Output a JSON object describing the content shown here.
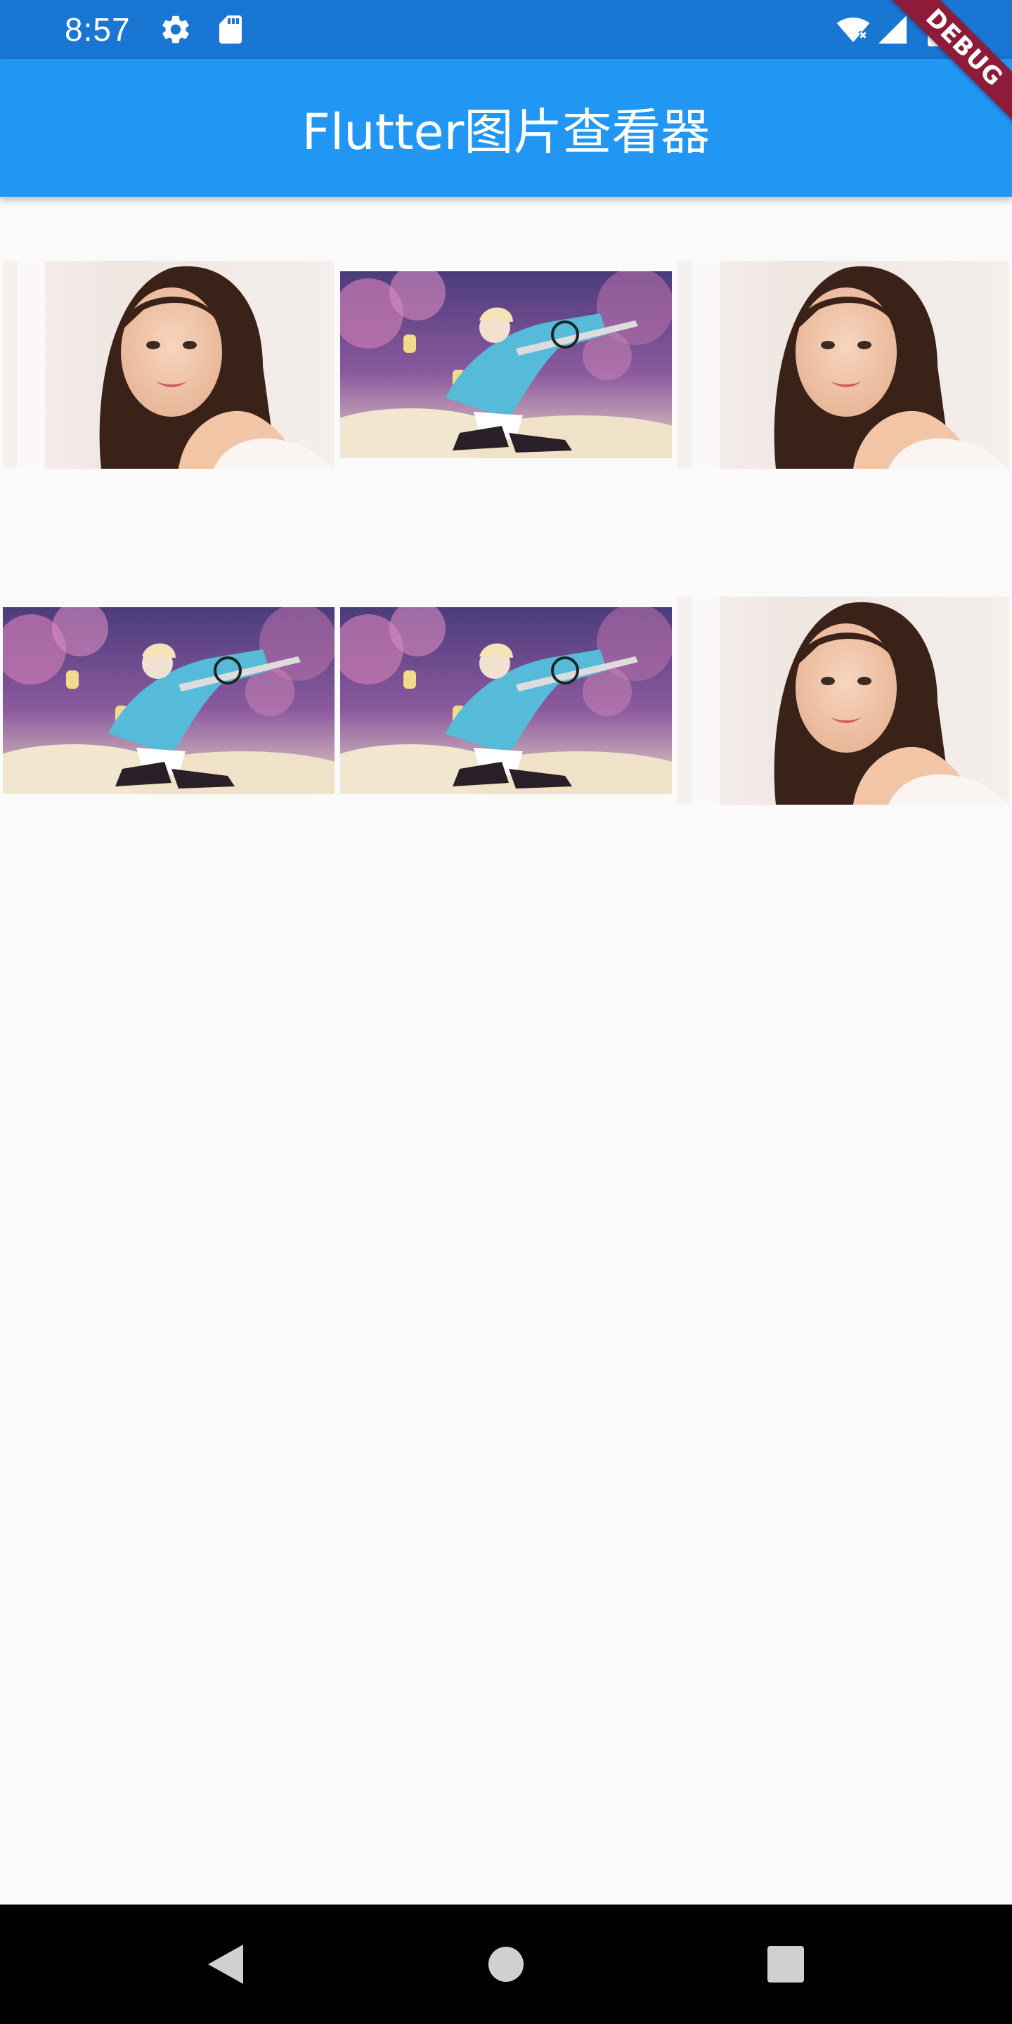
{
  "status_bar": {
    "time": "8:57",
    "left_icons": [
      "settings-icon",
      "sd-card-icon"
    ],
    "right_icons": [
      "wifi-icon",
      "cellular-signal-icon",
      "battery-icon"
    ]
  },
  "app_bar": {
    "title": "Flutter图片查看器",
    "background_color": "#2196F3",
    "status_bar_color": "#1976D2"
  },
  "debug_banner": {
    "label": "DEBUG"
  },
  "gallery": {
    "columns": 3,
    "images": [
      {
        "subject": "portrait-photo-girl",
        "alt": "portrait photo"
      },
      {
        "subject": "anime-swordswoman-cherry-blossoms",
        "alt": "anime illustration"
      },
      {
        "subject": "portrait-photo-girl",
        "alt": "portrait photo"
      },
      {
        "subject": "anime-swordswoman-cherry-blossoms",
        "alt": "anime illustration"
      },
      {
        "subject": "anime-swordswoman-cherry-blossoms",
        "alt": "anime illustration"
      },
      {
        "subject": "portrait-photo-girl",
        "alt": "portrait photo"
      }
    ]
  },
  "nav_bar": {
    "buttons": [
      "back-icon",
      "home-icon",
      "recents-icon"
    ]
  }
}
